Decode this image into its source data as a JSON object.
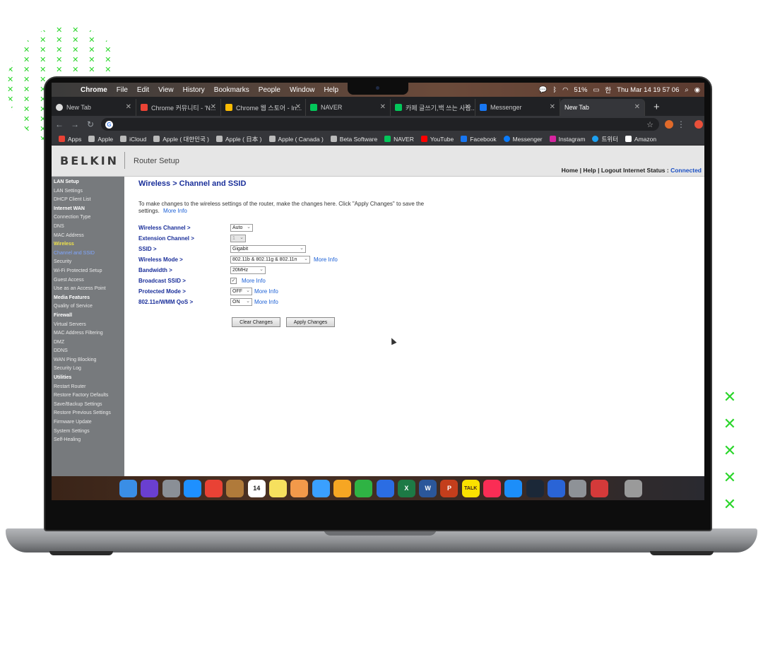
{
  "menubar": {
    "app": "Chrome",
    "items": [
      "File",
      "Edit",
      "View",
      "History",
      "Bookmarks",
      "People",
      "Window",
      "Help"
    ],
    "battery": "51%",
    "datetime": "Thu Mar 14  19 57 06"
  },
  "tabs": [
    {
      "label": "New Tab",
      "color": "#ffffff",
      "active": false
    },
    {
      "label": "Chrome 커뮤니티 - 'N...",
      "color": "#ea4335",
      "active": false
    },
    {
      "label": "Chrome 웹 스토어 - In...",
      "color": "#fbbc04",
      "active": false
    },
    {
      "label": "NAVER",
      "color": "#03c75a",
      "active": false
    },
    {
      "label": "카페 글쓰기,백 쓰는 사람...",
      "color": "#03c75a",
      "active": false
    },
    {
      "label": "Messenger",
      "color": "#1877f2",
      "active": false
    },
    {
      "label": "New Tab",
      "color": "#35363a",
      "active": true
    }
  ],
  "bookmarks": [
    {
      "label": "Apps",
      "color": "#e94235"
    },
    {
      "label": "Apple",
      "color": "#bbbbbb"
    },
    {
      "label": "iCloud",
      "color": "#bbbbbb"
    },
    {
      "label": "Apple ( 대한민국 )",
      "color": "#bbbbbb"
    },
    {
      "label": "Apple ( 日本 )",
      "color": "#bbbbbb"
    },
    {
      "label": "Apple ( Canada )",
      "color": "#bbbbbb"
    },
    {
      "label": "Beta Software",
      "color": "#bbbbbb"
    },
    {
      "label": "NAVER",
      "color": "#03c75a"
    },
    {
      "label": "YouTube",
      "color": "#ff0000"
    },
    {
      "label": "Facebook",
      "color": "#1877f2"
    },
    {
      "label": "Messenger",
      "color": "#0a7cff"
    },
    {
      "label": "Instagram",
      "color": "#d6249f"
    },
    {
      "label": "트위터",
      "color": "#1da1f2"
    },
    {
      "label": "Amazon",
      "color": "#ffffff"
    }
  ],
  "router": {
    "logo": "BELKIN",
    "title": "Router Setup",
    "toplinks": "Home  |  Help  |  Logout     Internet Status :",
    "status": "Connected",
    "heading": "Wireless > Channel and SSID",
    "intro": "To make changes to the wireless settings of the router, make the changes here. Click \"Apply Changes\" to save the settings.",
    "more_info": "More Info",
    "sidebar": [
      {
        "label": "LAN Setup",
        "type": "head"
      },
      {
        "label": "LAN Settings",
        "type": "item"
      },
      {
        "label": "DHCP Client List",
        "type": "item"
      },
      {
        "label": "Internet WAN",
        "type": "head"
      },
      {
        "label": "Connection Type",
        "type": "item"
      },
      {
        "label": "DNS",
        "type": "item"
      },
      {
        "label": "MAC Address",
        "type": "item"
      },
      {
        "label": "Wireless",
        "type": "sel"
      },
      {
        "label": "Channel and SSID",
        "type": "cur"
      },
      {
        "label": "Security",
        "type": "item"
      },
      {
        "label": "Wi-Fi Protected Setup",
        "type": "item"
      },
      {
        "label": "Guest Access",
        "type": "item"
      },
      {
        "label": "Use as an Access Point",
        "type": "item"
      },
      {
        "label": "Media Features",
        "type": "head"
      },
      {
        "label": "Quality of Service",
        "type": "item"
      },
      {
        "label": "Firewall",
        "type": "head"
      },
      {
        "label": "Virtual Servers",
        "type": "item"
      },
      {
        "label": "MAC Address Filtering",
        "type": "item"
      },
      {
        "label": "DMZ",
        "type": "item"
      },
      {
        "label": "DDNS",
        "type": "item"
      },
      {
        "label": "WAN Ping Blocking",
        "type": "item"
      },
      {
        "label": "Security Log",
        "type": "item"
      },
      {
        "label": "Utilities",
        "type": "head"
      },
      {
        "label": "Restart Router",
        "type": "item"
      },
      {
        "label": "Restore Factory Defaults",
        "type": "item"
      },
      {
        "label": "Save/Backup Settings",
        "type": "item"
      },
      {
        "label": "Restore Previous Settings",
        "type": "item"
      },
      {
        "label": "Firmware Update",
        "type": "item"
      },
      {
        "label": "System Settings",
        "type": "item"
      },
      {
        "label": "Self-Healing",
        "type": "item"
      }
    ],
    "fields": {
      "wireless_channel": {
        "label": "Wireless Channel >",
        "value": "Auto"
      },
      "extension_channel": {
        "label": "Extension Channel >",
        "value": "1"
      },
      "ssid": {
        "label": "SSID >",
        "value": "Gigabit"
      },
      "wireless_mode": {
        "label": "Wireless Mode >",
        "value": "802.11b & 802.11g & 802.11n"
      },
      "bandwidth": {
        "label": "Bandwidth >",
        "value": "20MHz"
      },
      "broadcast_ssid": {
        "label": "Broadcast SSID >",
        "value": "✓"
      },
      "protected_mode": {
        "label": "Protected Mode >",
        "value": "OFF"
      },
      "wmm_qos": {
        "label": "802.11e/WMM QoS >",
        "value": "ON"
      }
    },
    "buttons": {
      "clear": "Clear Changes",
      "apply": "Apply Changes"
    }
  },
  "dock": [
    {
      "name": "finder-icon",
      "color": "#3a8ee6",
      "text": ""
    },
    {
      "name": "siri-icon",
      "color": "#6a3fd0",
      "text": ""
    },
    {
      "name": "launchpad-icon",
      "color": "#8a8f96",
      "text": ""
    },
    {
      "name": "safari-icon",
      "color": "#1e90ff",
      "text": ""
    },
    {
      "name": "chrome-icon",
      "color": "#e94235",
      "text": ""
    },
    {
      "name": "notebook-icon",
      "color": "#b07a3a",
      "text": ""
    },
    {
      "name": "calendar-icon",
      "color": "#ffffff",
      "text": "14"
    },
    {
      "name": "notes-icon",
      "color": "#f6e05e",
      "text": ""
    },
    {
      "name": "photos-icon",
      "color": "#f2994a",
      "text": ""
    },
    {
      "name": "messages-icon",
      "color": "#3aa0ff",
      "text": ""
    },
    {
      "name": "pages-icon",
      "color": "#f6a623",
      "text": ""
    },
    {
      "name": "numbers-icon",
      "color": "#2fb344",
      "text": ""
    },
    {
      "name": "keynote-icon",
      "color": "#2b6de3",
      "text": ""
    },
    {
      "name": "excel-icon",
      "color": "#1d7a45",
      "text": "X"
    },
    {
      "name": "word-icon",
      "color": "#2b579a",
      "text": "W"
    },
    {
      "name": "powerpoint-icon",
      "color": "#c43e1c",
      "text": "P"
    },
    {
      "name": "kakaotalk-icon",
      "color": "#fae100",
      "text": "TALK"
    },
    {
      "name": "music-icon",
      "color": "#fa2d55",
      "text": ""
    },
    {
      "name": "app-store-icon",
      "color": "#1c8ef9",
      "text": ""
    },
    {
      "name": "steam-icon",
      "color": "#1b2838",
      "text": ""
    },
    {
      "name": "xcode-icon",
      "color": "#2a64d6",
      "text": ""
    },
    {
      "name": "system-preferences-icon",
      "color": "#8e9297",
      "text": ""
    },
    {
      "name": "parallels-icon",
      "color": "#d43a3a",
      "text": ""
    },
    {
      "name": "trash-icon",
      "color": "#9a9a9a",
      "text": ""
    }
  ]
}
